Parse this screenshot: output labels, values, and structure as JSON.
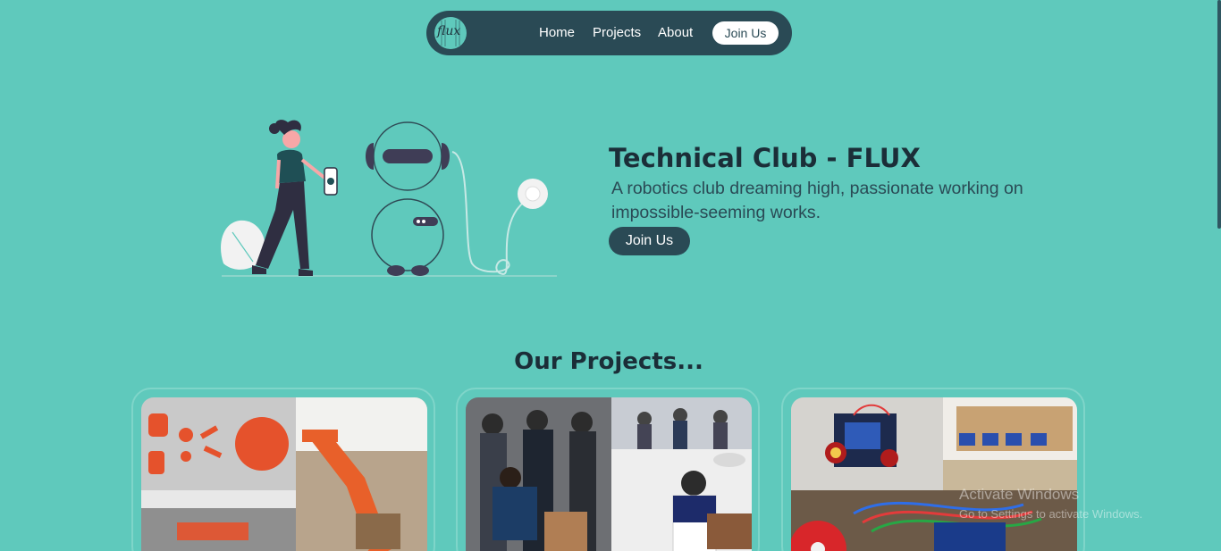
{
  "nav": {
    "logo_text": "flux",
    "links": [
      "Home",
      "Projects",
      "About"
    ],
    "join_label": "Join Us"
  },
  "hero": {
    "title": "Technical Club - FLUX",
    "subtitle": "A robotics club dreaming high, passionate working on impossible-seeming works.",
    "join_label": "Join Us"
  },
  "projects": {
    "title": "Our Projects..."
  },
  "watermark": {
    "line1": "Activate Windows",
    "line2": "Go to Settings to activate Windows."
  },
  "colors": {
    "background": "#5fc9bc",
    "nav_bg": "#2a4a55",
    "heading": "#1b2e38",
    "accent_orange": "#e5522c"
  }
}
